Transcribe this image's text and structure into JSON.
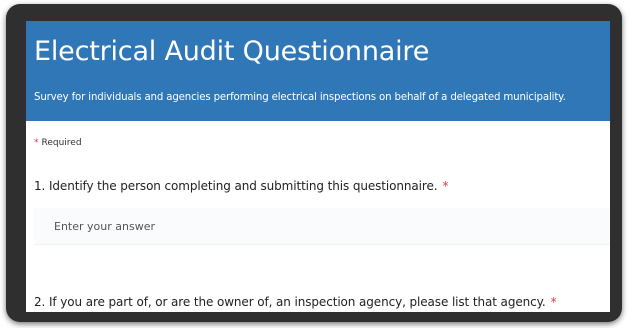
{
  "form": {
    "title": "Electrical Audit Questionnaire",
    "subtitle": "Survey for individuals and agencies performing electrical inspections on behalf of a delegated municipality.",
    "required_star": "*",
    "required_label": "Required"
  },
  "questions": [
    {
      "text": "1. Identify the person completing and submitting this questionnaire.",
      "required_star": "*",
      "answer_placeholder": "Enter your answer"
    },
    {
      "text": "2. If you are part of, or are the owner of, an inspection agency, please list that agency.",
      "required_star": "*"
    }
  ],
  "colors": {
    "banner": "#3077b8",
    "frame": "#2f2f2f",
    "required": "#e0363f"
  }
}
